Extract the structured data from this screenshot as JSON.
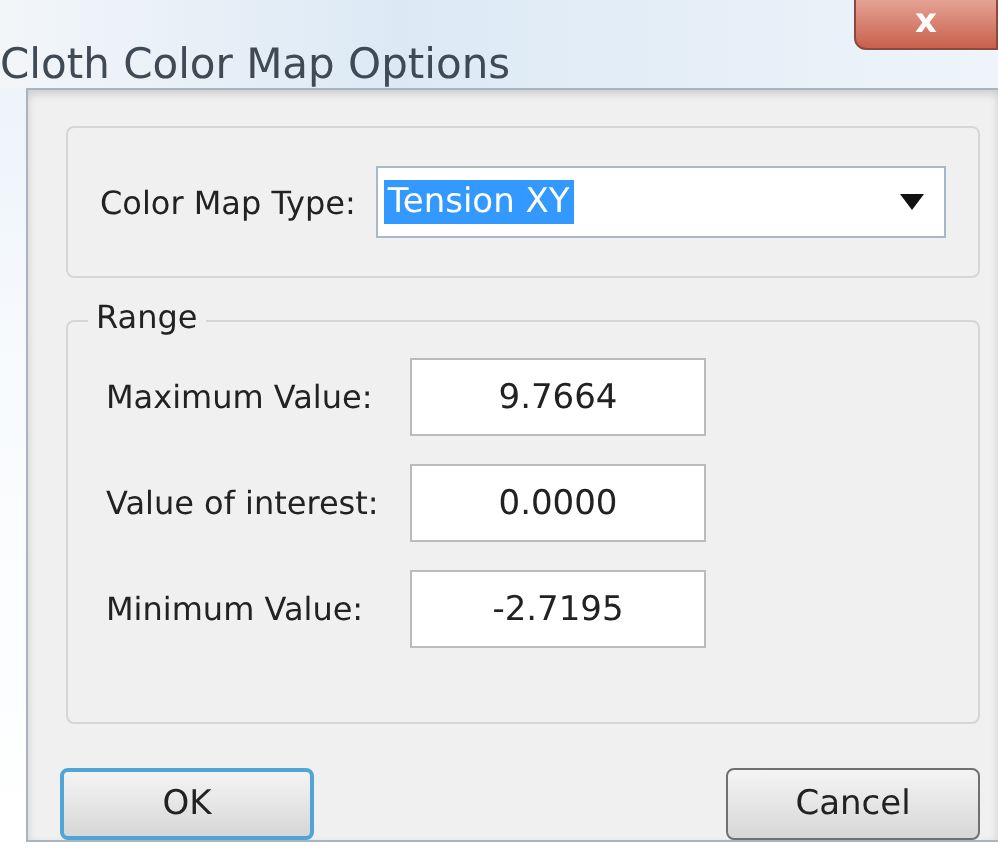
{
  "window": {
    "title": "Cloth Color Map Options",
    "close_button": "x"
  },
  "color_map_type": {
    "label": "Color Map Type:",
    "value": "Tension XY",
    "text_selected": true
  },
  "range": {
    "title": "Range",
    "fields": [
      {
        "label": "Maximum Value:",
        "value": "9.7664"
      },
      {
        "label": "Value of interest:",
        "value": "0.0000"
      },
      {
        "label": "Minimum Value:",
        "value": "-2.7195"
      }
    ]
  },
  "buttons": [
    {
      "label": "OK",
      "default": true
    },
    {
      "label": "Cancel",
      "default": false
    }
  ]
}
